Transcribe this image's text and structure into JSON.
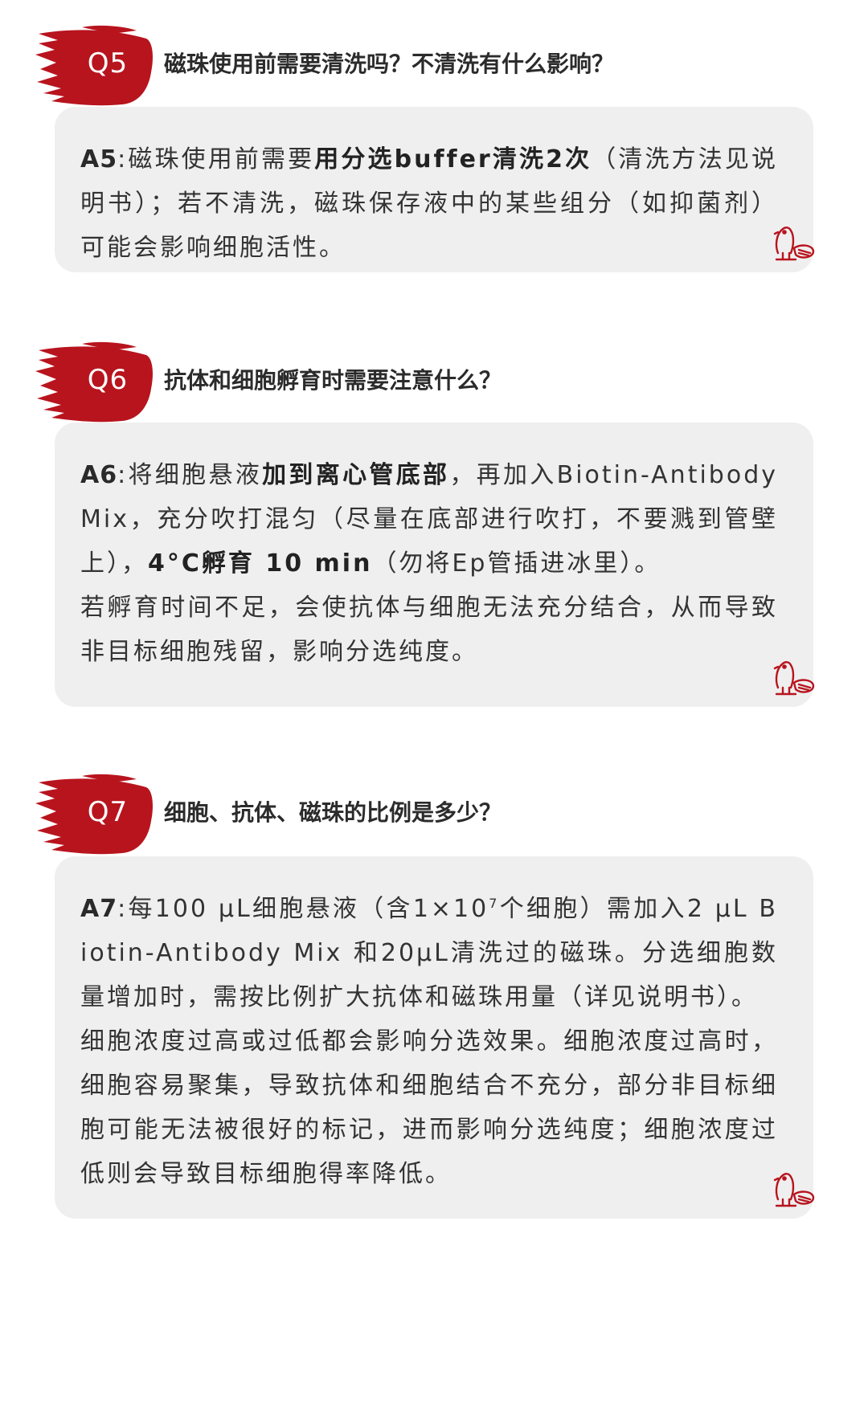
{
  "qas": [
    {
      "badge": "Q5",
      "question": "磁珠使用前需要清洗吗？不清洗有什么影响？",
      "answer": {
        "label": "A5",
        "segments": [
          {
            "text": ":磁珠使用前需要",
            "bold": false
          },
          {
            "text": "用分选buffer清洗2次",
            "bold": true
          },
          {
            "text": "（清洗方法见说明书）；若不清洗，磁珠保存液中的某些组分（如抑菌剂）可能会影响细胞活性。",
            "bold": false
          }
        ]
      }
    },
    {
      "badge": "Q6",
      "question": "抗体和细胞孵育时需要注意什么？",
      "answer": {
        "label": "A6",
        "segments": [
          {
            "text": ":将细胞悬液",
            "bold": false
          },
          {
            "text": "加到离心管底部",
            "bold": true
          },
          {
            "text": "，再加入Biotin-Antibody Mix，充分吹打混匀（尽量在底部进行吹打，不要溅到管壁上），",
            "bold": false
          },
          {
            "text": "4°C孵育 10 min",
            "bold": true
          },
          {
            "text": "（勿将Ep管插进冰里）。",
            "bold": false
          },
          {
            "text": "若孵育时间不足，会使抗体与细胞无法充分结合，从而导致非目标细胞残留，影响分选纯度。",
            "bold": false,
            "newline": true
          }
        ]
      }
    },
    {
      "badge": "Q7",
      "question": "细胞、抗体、磁珠的比例是多少？",
      "answer": {
        "label": "A7",
        "segments": [
          {
            "text": ":每100 μL细胞悬液（含1×10",
            "bold": false
          },
          {
            "text": "7",
            "bold": false,
            "sup": true
          },
          {
            "text": "个细胞）需加入2 μL Biotin-Antibody Mix 和20μL清洗过的磁珠。分选细胞数量增加时，需按比例扩大抗体和磁珠用量（详见说明书）。",
            "bold": false
          },
          {
            "text": "细胞浓度过高或过低都会影响分选效果。细胞浓度过高时，细胞容易聚集，导致抗体和细胞结合不充分，部分非目标细胞可能无法被很好的标记，进而影响分选纯度；细胞浓度过低则会导致目标细胞得率降低。",
            "bold": false,
            "newline": true
          }
        ]
      }
    }
  ],
  "colors": {
    "badge_red": "#b8141e",
    "card_bg": "#efefef",
    "text": "#333333",
    "question_text": "#2b2b2b"
  },
  "icons": {
    "badge": "brush-stroke-badge",
    "mascot": "beaver-mascot-icon"
  }
}
